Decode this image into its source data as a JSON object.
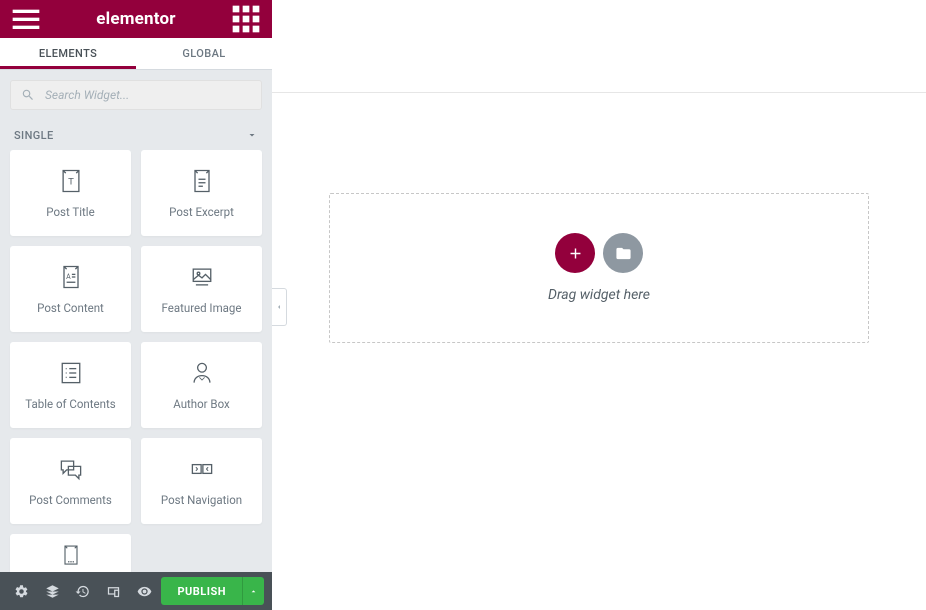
{
  "app": {
    "logo": "elementor"
  },
  "tabs": {
    "elements": "ELEMENTS",
    "global": "GLOBAL"
  },
  "search": {
    "placeholder": "Search Widget..."
  },
  "section": {
    "title": "SINGLE"
  },
  "widgets": [
    {
      "label": "Post Title"
    },
    {
      "label": "Post Excerpt"
    },
    {
      "label": "Post Content"
    },
    {
      "label": "Featured Image"
    },
    {
      "label": "Table of Contents"
    },
    {
      "label": "Author Box"
    },
    {
      "label": "Post Comments"
    },
    {
      "label": "Post Navigation"
    }
  ],
  "footer": {
    "publish": "PUBLISH"
  },
  "canvas": {
    "drop_text": "Drag widget here"
  }
}
